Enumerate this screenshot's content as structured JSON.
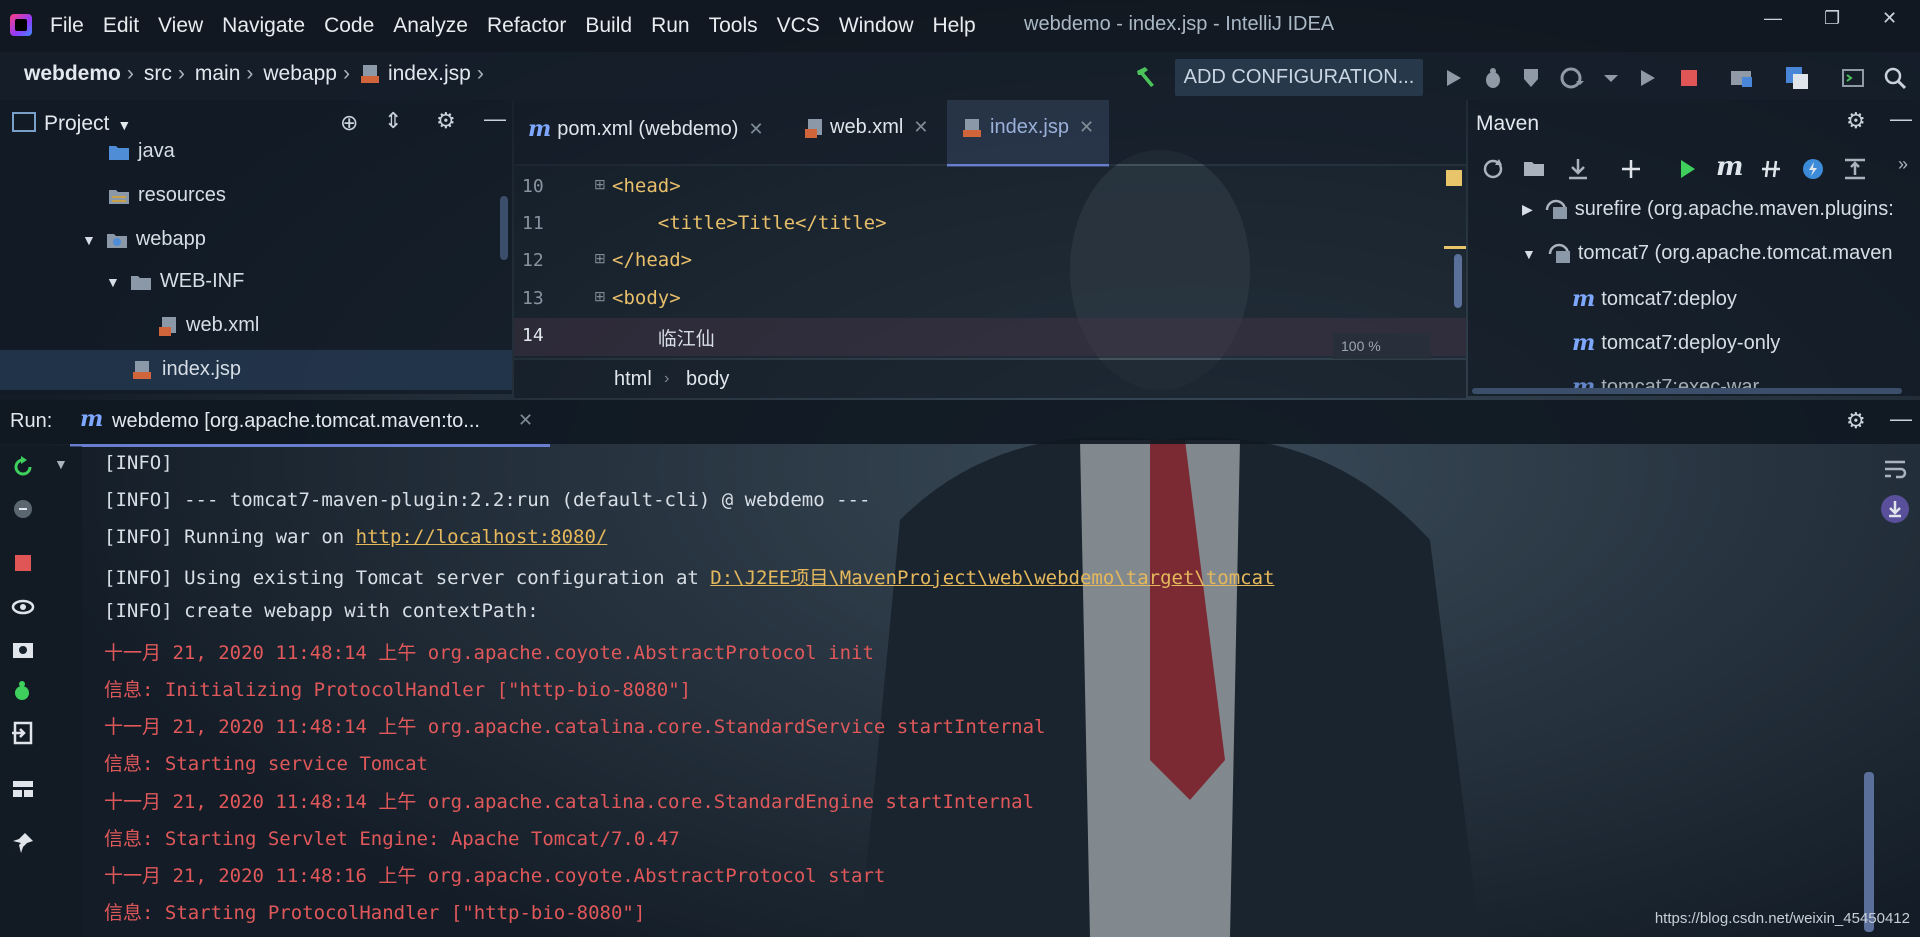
{
  "app": {
    "menu": [
      "File",
      "Edit",
      "View",
      "Navigate",
      "Code",
      "Analyze",
      "Refactor",
      "Build",
      "Run",
      "Tools",
      "VCS",
      "Window",
      "Help"
    ],
    "title": "webdemo - index.jsp - IntelliJ IDEA"
  },
  "navbar": {
    "crumbs": [
      "webdemo",
      "src",
      "main",
      "webapp",
      "index.jsp"
    ],
    "add_config_label": "ADD CONFIGURATION..."
  },
  "project": {
    "header": "Project",
    "tree": [
      {
        "label": "java",
        "icon": "folder"
      },
      {
        "label": "resources",
        "icon": "folder-resources"
      },
      {
        "label": "webapp",
        "icon": "folder-web"
      },
      {
        "label": "WEB-INF",
        "icon": "folder"
      },
      {
        "label": "web.xml",
        "icon": "xml-file"
      },
      {
        "label": "index.jsp",
        "icon": "jsp-file"
      }
    ]
  },
  "editor": {
    "tabs": [
      "pom.xml (webdemo)",
      "web.xml",
      "index.jsp"
    ],
    "active_tab": "index.jsp",
    "lines": [
      {
        "num": "10",
        "code": "<head>"
      },
      {
        "num": "11",
        "code": "    <title>Title</title>"
      },
      {
        "num": "12",
        "code": "</head>"
      },
      {
        "num": "13",
        "code": "<body>"
      },
      {
        "num": "14",
        "code": "    临江仙"
      }
    ],
    "zoom": "100 %",
    "breadcrumb": [
      "html",
      "body"
    ]
  },
  "maven": {
    "title": "Maven",
    "items": [
      {
        "label": "surefire (org.apache.maven.plugins:",
        "kind": "plugin",
        "expanded": false
      },
      {
        "label": "tomcat7 (org.apache.tomcat.maven",
        "kind": "plugin",
        "expanded": true
      },
      {
        "label": "tomcat7:deploy",
        "kind": "goal"
      },
      {
        "label": "tomcat7:deploy-only",
        "kind": "goal"
      },
      {
        "label": "tomcat7:exec-war",
        "kind": "goal"
      }
    ]
  },
  "run": {
    "label": "Run:",
    "tab_label": "webdemo [org.apache.tomcat.maven:to...",
    "console": [
      {
        "text": "[INFO]",
        "type": "info"
      },
      {
        "text": "[INFO] --- tomcat7-maven-plugin:2.2:run (default-cli) @ webdemo ---",
        "type": "info"
      },
      {
        "prefix": "[INFO] Running war on ",
        "link": "http://localhost:8080/",
        "type": "info"
      },
      {
        "prefix": "[INFO] Using existing Tomcat server configuration at ",
        "link": "D:\\J2EE项目\\MavenProject\\web\\webdemo\\target\\tomcat",
        "type": "info"
      },
      {
        "text": "[INFO] create webapp with contextPath:",
        "type": "info"
      },
      {
        "text": "十一月 21, 2020 11:48:14 上午 org.apache.coyote.AbstractProtocol init",
        "type": "err"
      },
      {
        "text": "信息: Initializing ProtocolHandler [\"http-bio-8080\"]",
        "type": "err"
      },
      {
        "text": "十一月 21, 2020 11:48:14 上午 org.apache.catalina.core.StandardService startInternal",
        "type": "err"
      },
      {
        "text": "信息: Starting service Tomcat",
        "type": "err"
      },
      {
        "text": "十一月 21, 2020 11:48:14 上午 org.apache.catalina.core.StandardEngine startInternal",
        "type": "err"
      },
      {
        "text": "信息: Starting Servlet Engine: Apache Tomcat/7.0.47",
        "type": "err"
      },
      {
        "text": "十一月 21, 2020 11:48:16 上午 org.apache.coyote.AbstractProtocol start",
        "type": "err"
      },
      {
        "text": "信息: Starting ProtocolHandler [\"http-bio-8080\"]",
        "type": "err"
      }
    ]
  },
  "watermark": "https://blog.csdn.net/weixin_45450412",
  "colors": {
    "accent": "#6a7ecf",
    "tag": "#e8bf6a",
    "error_text": "#e0585a",
    "link": "#e6b85c",
    "run_green": "#3ecf5c",
    "stop_red": "#e05555"
  }
}
